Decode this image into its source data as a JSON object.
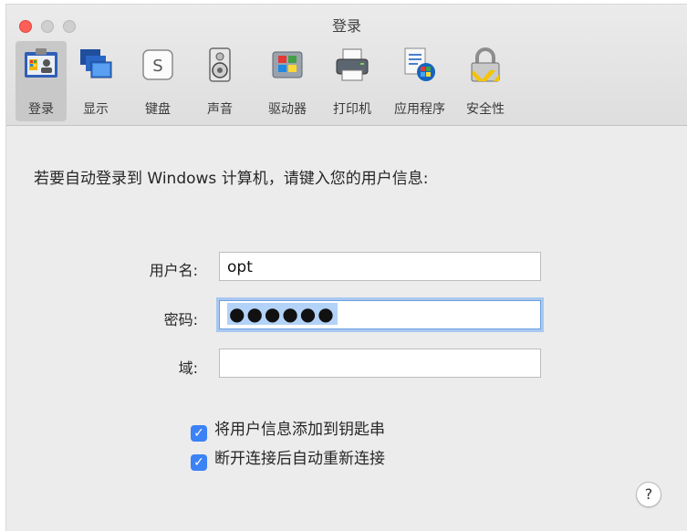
{
  "window": {
    "title": "登录"
  },
  "toolbar": {
    "items": [
      {
        "label": "登录",
        "icon": "login-icon"
      },
      {
        "label": "显示",
        "icon": "display-icon"
      },
      {
        "label": "键盘",
        "icon": "keyboard-icon"
      },
      {
        "label": "声音",
        "icon": "sound-icon"
      },
      {
        "label": "驱动器",
        "icon": "drives-icon"
      },
      {
        "label": "打印机",
        "icon": "printer-icon"
      },
      {
        "label": "应用程序",
        "icon": "applications-icon"
      },
      {
        "label": "安全性",
        "icon": "security-icon"
      }
    ],
    "active": "登录"
  },
  "form": {
    "intro": "若要自动登录到 Windows 计算机，请键入您的用户信息:",
    "username_label": "用户名:",
    "username_value": "opt",
    "password_label": "密码:",
    "password_value": "●●●●●●",
    "domain_label": "域:",
    "domain_value": ""
  },
  "options": {
    "add_to_keychain": {
      "label": "将用户信息添加到钥匙串",
      "checked": true
    },
    "reconnect": {
      "label": "断开连接后自动重新连接",
      "checked": true
    }
  },
  "help": {
    "label": "?"
  },
  "colors": {
    "accent": "#3b82f6",
    "close": "#fd5f57"
  }
}
